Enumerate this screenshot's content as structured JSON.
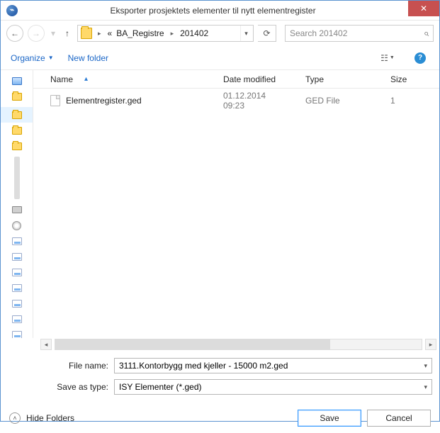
{
  "window": {
    "title": "Eksporter prosjektets elementer til nytt elementregister"
  },
  "breadcrumb": {
    "prefix": "«",
    "items": [
      "BA_Registre",
      "201402"
    ]
  },
  "search": {
    "placeholder": "Search 201402"
  },
  "toolbar": {
    "organize": "Organize",
    "new_folder": "New folder"
  },
  "columns": {
    "name": "Name",
    "date": "Date modified",
    "type": "Type",
    "size": "Size"
  },
  "files": [
    {
      "name": "Elementregister.ged",
      "date": "01.12.2014 09:23",
      "type": "GED File",
      "size": "1"
    }
  ],
  "form": {
    "file_name_label": "File name:",
    "file_name_value": "3111.Kontorbygg med kjeller - 15000 m2.ged",
    "save_type_label": "Save as type:",
    "save_type_value": "ISY Elementer (*.ged)"
  },
  "footer": {
    "hide_folders": "Hide Folders",
    "save": "Save",
    "cancel": "Cancel"
  }
}
